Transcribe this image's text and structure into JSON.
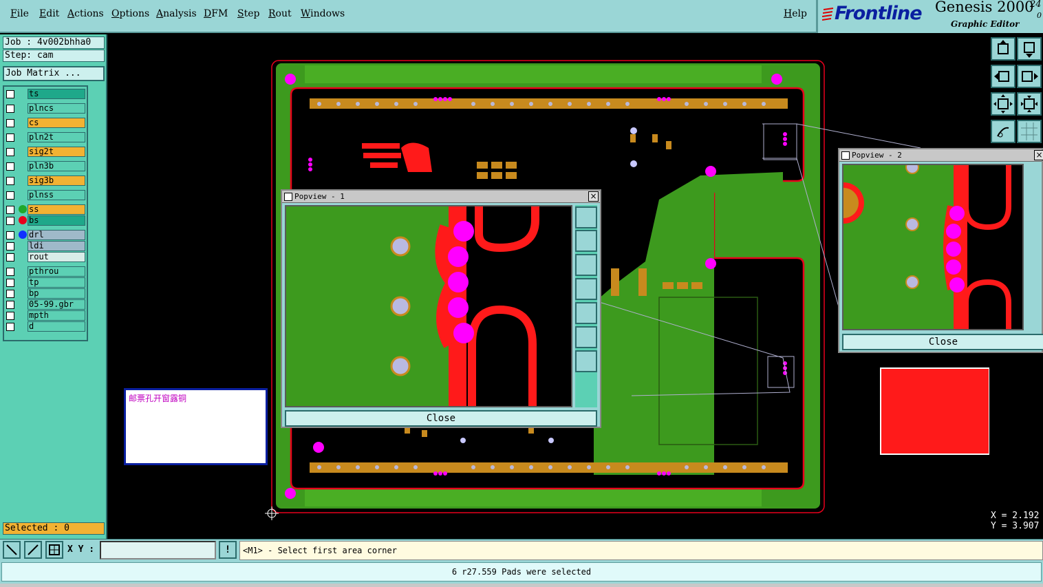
{
  "menu": {
    "file": "File",
    "edit": "Edit",
    "actions": "Actions",
    "options": "Options",
    "analysis": "Analysis",
    "dfm": "DFM",
    "step": "Step",
    "rout": "Rout",
    "windows": "Windows",
    "help": "Help"
  },
  "brand": {
    "logo": "Frontline",
    "product": "Genesis 2000",
    "subtitle": "Graphic Editor",
    "version_fragment": "24",
    "version_fragment2": "0"
  },
  "job": {
    "job_label": "Job : 4v002bhha0",
    "step_label": "Step: cam",
    "matrix_button": "Job Matrix ..."
  },
  "layers": [
    {
      "name": "ts",
      "bg": "#1fa88a"
    },
    {
      "name": "plncs",
      "bg": "#5cd0b4"
    },
    {
      "name": "cs",
      "bg": "#f2b233"
    },
    {
      "name": "pln2t",
      "bg": "#5cd0b4"
    },
    {
      "name": "sig2t",
      "bg": "#f2b233"
    },
    {
      "name": "pln3b",
      "bg": "#5cd0b4"
    },
    {
      "name": "sig3b",
      "bg": "#f2b233"
    },
    {
      "name": "plnss",
      "bg": "#5cd0b4"
    },
    {
      "name": "ss",
      "bg": "#f2b233"
    },
    {
      "name": "bs",
      "bg": "#1fa88a"
    },
    {
      "name": "drl",
      "bg": "#9fb9c9"
    },
    {
      "name": "ldi",
      "bg": "#9fb9c9"
    },
    {
      "name": "rout",
      "bg": "#d8ece8"
    },
    {
      "name": "pthrou",
      "bg": "#5cd0b4"
    },
    {
      "name": "tp",
      "bg": "#5cd0b4"
    },
    {
      "name": "bp",
      "bg": "#5cd0b4"
    },
    {
      "name": "05-99.gbr",
      "bg": "#5cd0b4"
    },
    {
      "name": "mpth",
      "bg": "#5cd0b4"
    },
    {
      "name": "d",
      "bg": "#5cd0b4"
    }
  ],
  "selected": "Selected : 0",
  "note": "邮票孔开窗露铜",
  "popview1": {
    "title": "Popview - 1",
    "close": "Close",
    "close_x": "×"
  },
  "popview2": {
    "title": "Popview - 2",
    "close": "Close",
    "close_x": "×"
  },
  "bottom": {
    "xy_label": "X Y :",
    "xy_value": "",
    "bang": "!",
    "prompt": "<M1> - Select first area corner"
  },
  "status": "6 r27.559 Pads were selected",
  "coords": {
    "x": "X = 2.192",
    "y": "Y = 3.907"
  },
  "colors": {
    "panel": "#9ad6d6",
    "board": "#3d9a1e",
    "copper": "#c88a1e",
    "pad": "#ff00ff",
    "rout": "#ff0000",
    "outline": "#e8001c"
  }
}
